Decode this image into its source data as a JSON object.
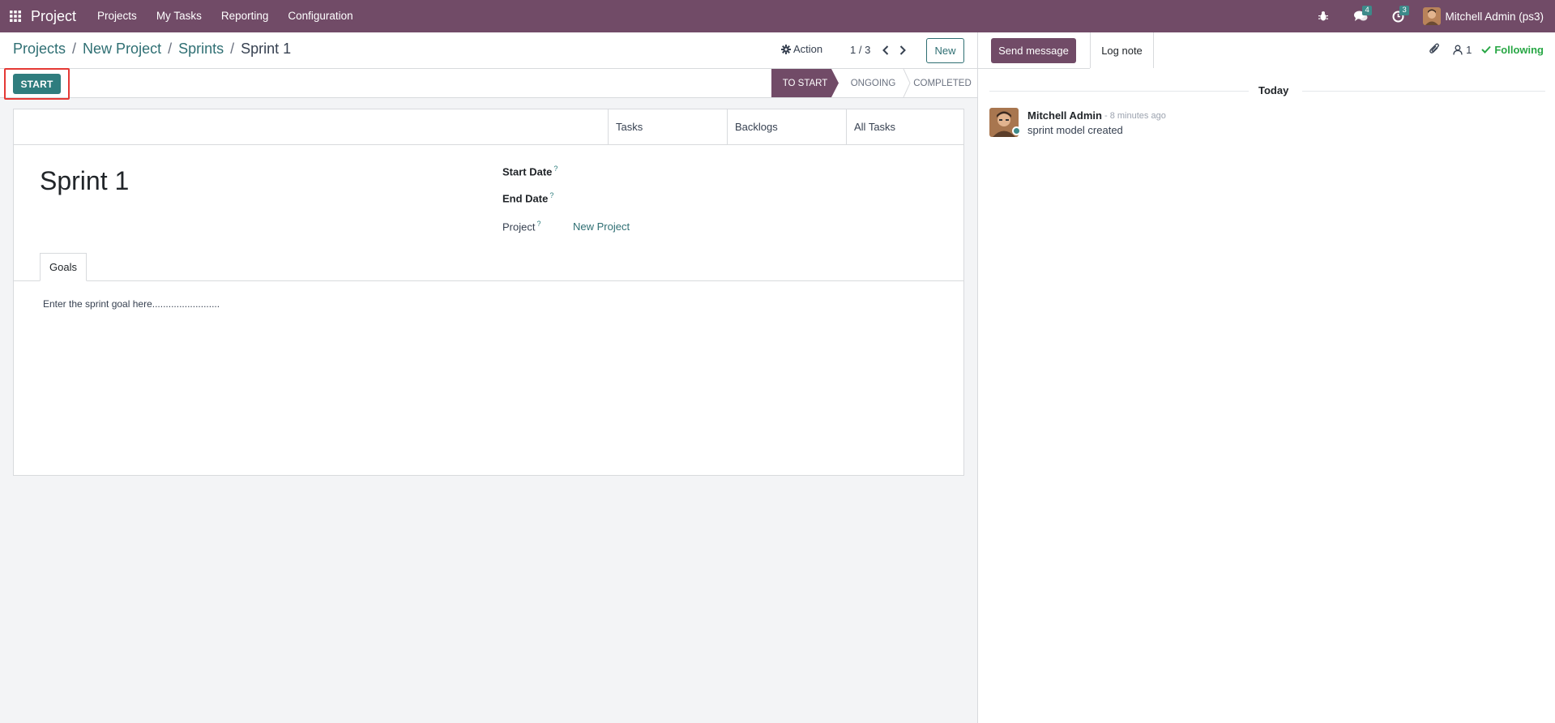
{
  "navbar": {
    "app_name": "Project",
    "menu": [
      "Projects",
      "My Tasks",
      "Reporting",
      "Configuration"
    ],
    "messages_count": "4",
    "activities_count": "3",
    "user_name": "Mitchell Admin (ps3)"
  },
  "control_panel": {
    "breadcrumb": [
      "Projects",
      "New Project",
      "Sprints"
    ],
    "current": "Sprint 1",
    "action_label": "Action",
    "pager": "1 / 3",
    "new_label": "New"
  },
  "statusbar": {
    "start_label": "START",
    "stages": [
      "TO START",
      "ONGOING",
      "COMPLETED"
    ],
    "active_stage": "TO START"
  },
  "form": {
    "smart_buttons": [
      "Tasks",
      "Backlogs",
      "All Tasks"
    ],
    "title": "Sprint 1",
    "fields": {
      "start_date_label": "Start Date",
      "end_date_label": "End Date",
      "project_label": "Project",
      "project_value": "New Project",
      "help_mark": "?"
    },
    "tab_label": "Goals",
    "goal_text": "Enter the sprint goal here........................."
  },
  "chatter": {
    "send_message_label": "Send message",
    "log_note_label": "Log note",
    "followers_count": "1",
    "following_label": "Following",
    "date_separator": "Today",
    "message": {
      "author": "Mitchell Admin",
      "time": "- 8 minutes ago",
      "body": "sprint model created"
    }
  },
  "colors": {
    "brand": "#714b67",
    "accent": "#2f7d7e",
    "highlight": "#e53935"
  }
}
